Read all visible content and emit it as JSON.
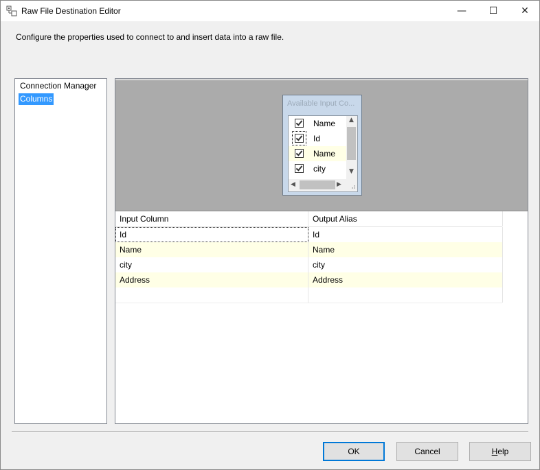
{
  "window": {
    "title": "Raw File Destination Editor",
    "minimize": "—",
    "maximize": "☐",
    "close": "✕"
  },
  "description": "Configure the properties used to connect to and insert data into a raw file.",
  "nav": {
    "items": [
      {
        "label": "Connection Manager",
        "selected": false
      },
      {
        "label": "Columns",
        "selected": true
      }
    ]
  },
  "available_columns": {
    "title": "Available Input Co...",
    "items": [
      {
        "label": "Name",
        "checked": true
      },
      {
        "label": "Id",
        "checked": true
      },
      {
        "label": "Name",
        "checked": true
      },
      {
        "label": "city",
        "checked": true
      }
    ]
  },
  "grid": {
    "headers": [
      "Input Column",
      "Output Alias"
    ],
    "rows": [
      [
        "Id",
        "Id"
      ],
      [
        "Name",
        "Name"
      ],
      [
        "city",
        "city"
      ],
      [
        "Address",
        "Address"
      ],
      [
        "",
        ""
      ]
    ]
  },
  "buttons": {
    "ok": "OK",
    "cancel": "Cancel",
    "help": "Help"
  },
  "colors": {
    "selection": "#3399ff",
    "alt_row": "#ffffe6",
    "mapping_bg": "#ababab",
    "input_box_bg": "#c8d8ea",
    "default_button_border": "#0078d7"
  }
}
